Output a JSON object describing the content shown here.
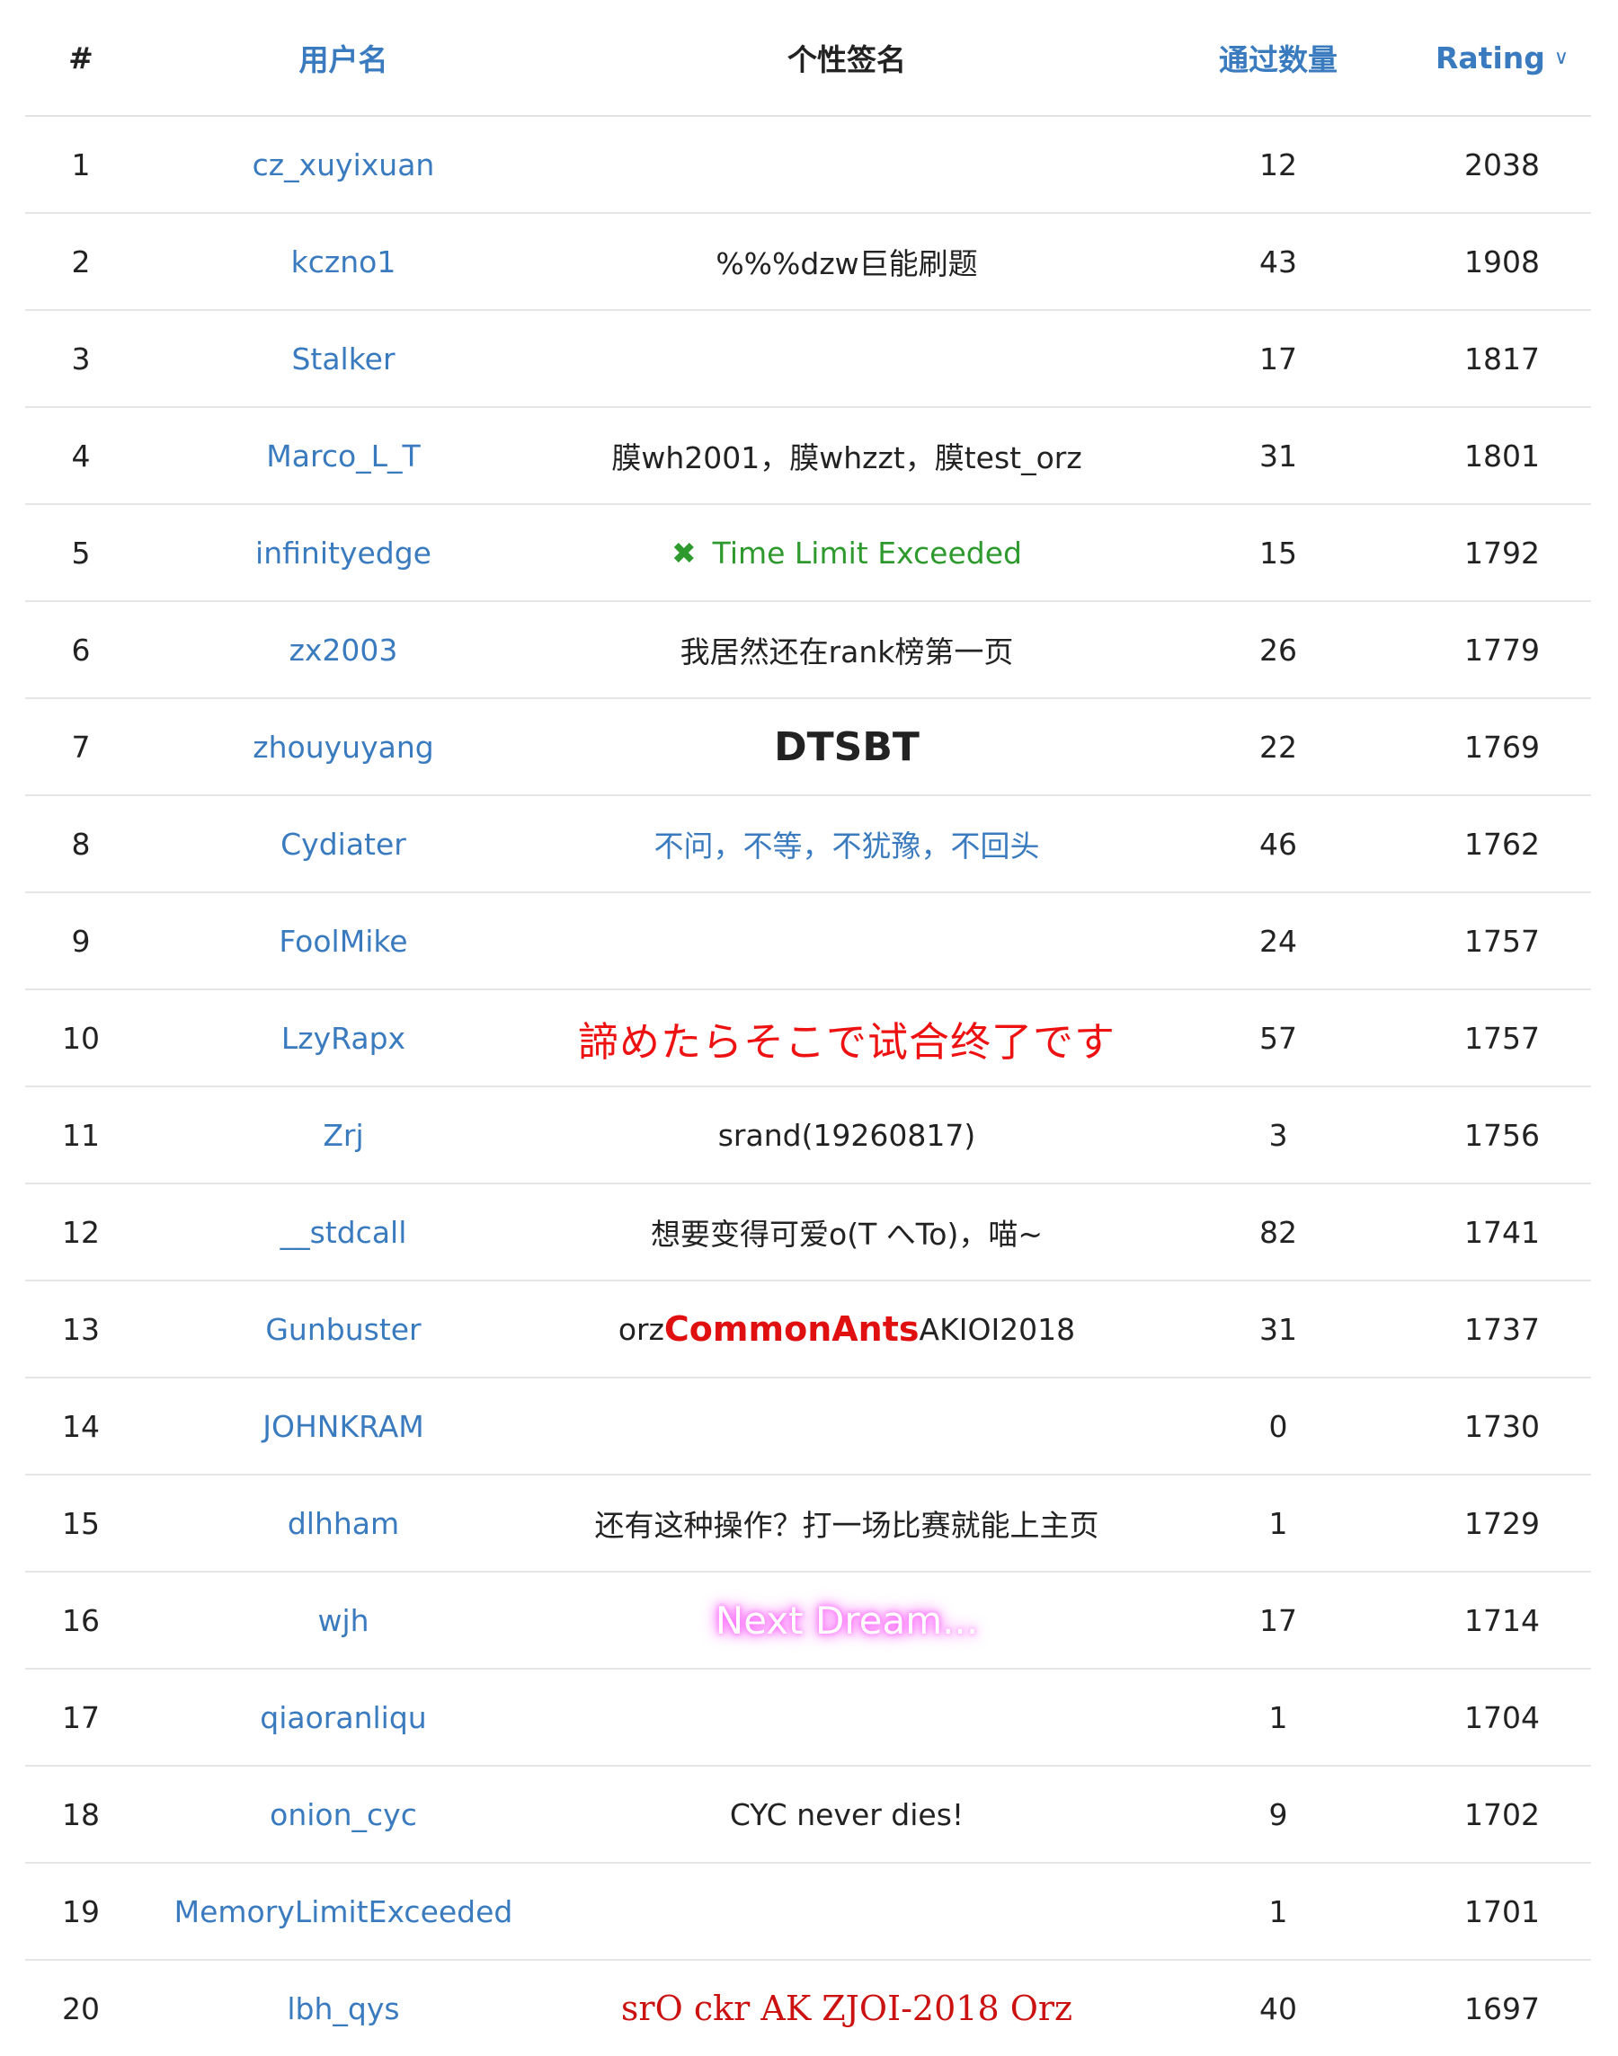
{
  "header": {
    "rank": "#",
    "username": "用户名",
    "signature": "个性签名",
    "accepted": "通过数量",
    "rating": "Rating",
    "sort_icon": "chevron-down-icon"
  },
  "rows": [
    {
      "rank": "1",
      "user": "cz_xuyixuan",
      "sig": "",
      "accepted": "12",
      "rating": "2038"
    },
    {
      "rank": "2",
      "user": "kczno1",
      "sig": "%%%dzw巨能刷题",
      "accepted": "43",
      "rating": "1908"
    },
    {
      "rank": "3",
      "user": "Stalker",
      "sig": "",
      "accepted": "17",
      "rating": "1817"
    },
    {
      "rank": "4",
      "user": "Marco_L_T",
      "sig": "膜wh2001，膜whzzt，膜test_orz",
      "accepted": "31",
      "rating": "1801"
    },
    {
      "rank": "5",
      "user": "infinityedge",
      "sig": "Time Limit Exceeded",
      "sig_icon": "✖",
      "accepted": "15",
      "rating": "1792"
    },
    {
      "rank": "6",
      "user": "zx2003",
      "sig": "我居然还在rank榜第一页",
      "accepted": "26",
      "rating": "1779"
    },
    {
      "rank": "7",
      "user": "zhouyuyang",
      "sig": "DTSBT",
      "accepted": "22",
      "rating": "1769"
    },
    {
      "rank": "8",
      "user": "Cydiater",
      "sig": "不问，不等，不犹豫，不回头",
      "accepted": "46",
      "rating": "1762"
    },
    {
      "rank": "9",
      "user": "FoolMike",
      "sig": "",
      "accepted": "24",
      "rating": "1757"
    },
    {
      "rank": "10",
      "user": "LzyRapx",
      "sig": "諦めたらそこで试合终了です",
      "accepted": "57",
      "rating": "1757"
    },
    {
      "rank": "11",
      "user": "Zrj",
      "sig": "srand(19260817)",
      "accepted": "3",
      "rating": "1756"
    },
    {
      "rank": "12",
      "user": "__stdcall",
      "sig": "想要变得可爱o(T へTo)，喵~",
      "accepted": "82",
      "rating": "1741"
    },
    {
      "rank": "13",
      "user": "Gunbuster",
      "sig_a": "orz",
      "sig_b": "CommonAnts",
      "sig_c": "AKIOI2018",
      "accepted": "31",
      "rating": "1737"
    },
    {
      "rank": "14",
      "user": "JOHNKRAM",
      "sig": "",
      "accepted": "0",
      "rating": "1730"
    },
    {
      "rank": "15",
      "user": "dlhham",
      "sig": "还有这种操作？打一场比赛就能上主页",
      "accepted": "1",
      "rating": "1729"
    },
    {
      "rank": "16",
      "user": "wjh",
      "sig": "Next Dream...",
      "accepted": "17",
      "rating": "1714"
    },
    {
      "rank": "17",
      "user": "qiaoranliqu",
      "sig": "",
      "accepted": "1",
      "rating": "1704"
    },
    {
      "rank": "18",
      "user": "onion_cyc",
      "sig": "CYC never dies!",
      "accepted": "9",
      "rating": "1702"
    },
    {
      "rank": "19",
      "user": "MemoryLimitExceeded",
      "sig": "",
      "accepted": "1",
      "rating": "1701"
    },
    {
      "rank": "20",
      "user": "lbh_qys",
      "sig": "srO ckr AK ZJOI-2018 Orz",
      "accepted": "40",
      "rating": "1697"
    }
  ]
}
